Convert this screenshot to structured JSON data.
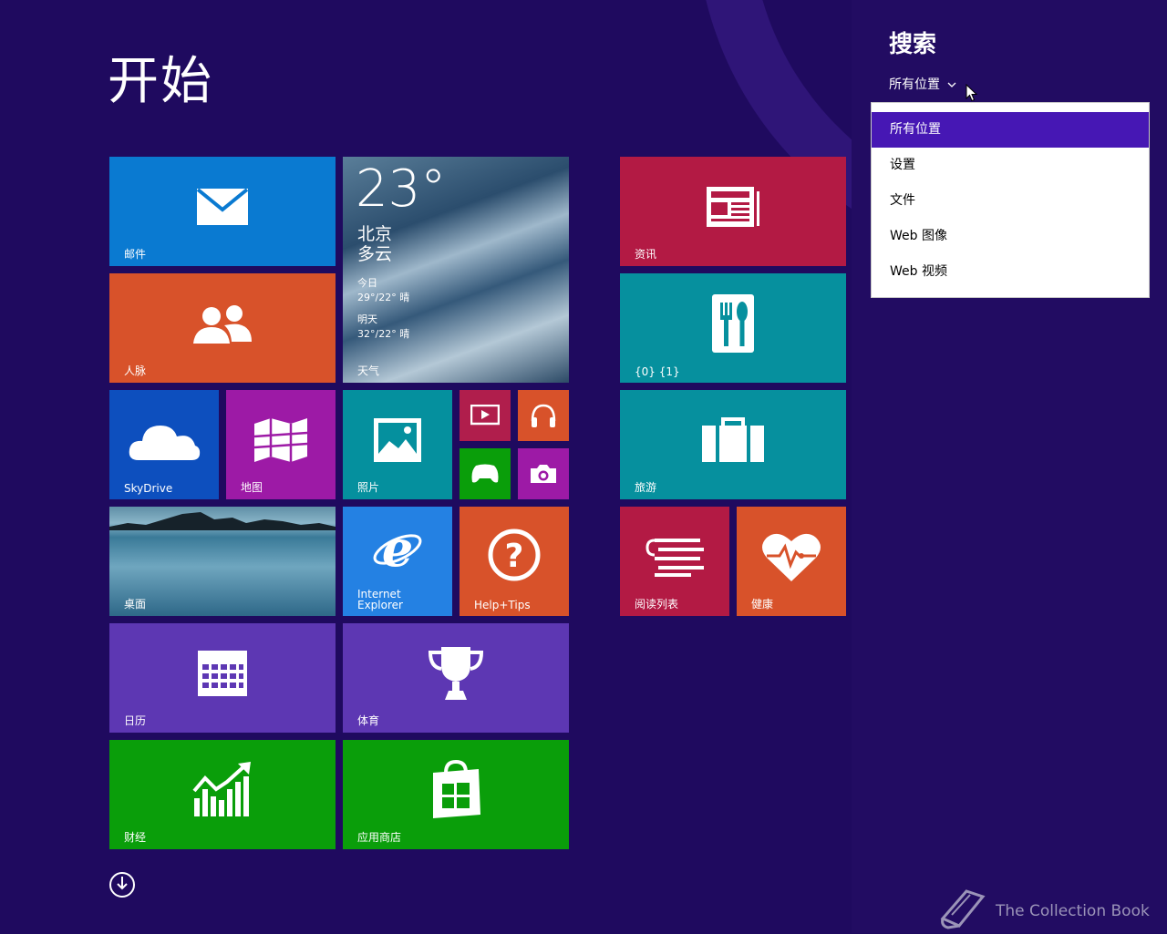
{
  "start": {
    "title": "开始",
    "tiles": {
      "mail": "邮件",
      "people": "人脉",
      "skydrive": "SkyDrive",
      "maps": "地图",
      "photos": "照片",
      "desktop": "桌面",
      "ie": "Internet\nExplorer",
      "help": "Help+Tips",
      "calendar": "日历",
      "sports": "体育",
      "finance": "财经",
      "store": "应用商店",
      "news": "资讯",
      "food": "{0} {1}",
      "travel": "旅游",
      "readinglist": "阅读列表",
      "health": "健康"
    },
    "weather": {
      "temp": "23°",
      "city": "北京",
      "condition": "多云",
      "today_label": "今日",
      "today_value": "29°/22° 晴",
      "tomorrow_label": "明天",
      "tomorrow_value": "32°/22° 晴",
      "label": "天气"
    }
  },
  "search": {
    "title": "搜索",
    "scope": "所有位置",
    "options": [
      "所有位置",
      "设置",
      "文件",
      "Web 图像",
      "Web 视频"
    ],
    "selected_index": 0
  },
  "watermark": "The Collection Book",
  "colors": {
    "background": "#1f0a5f",
    "mail": "#0a7ad1",
    "people": "#d8522a",
    "skydrive": "#0d4fbe",
    "maps": "#9d1aa6",
    "photos": "#05909e",
    "video": "#b01e4c",
    "music": "#d8522a",
    "games": "#0a9e0a",
    "camera": "#9d1aa6",
    "ie": "#2481e3",
    "help": "#d8522a",
    "calendar": "#5d37b3",
    "sports": "#5d37b3",
    "finance": "#0a9e0a",
    "store": "#0a9e0a",
    "news": "#b31a44",
    "food": "#06909e",
    "travel": "#06909e",
    "readinglist": "#b31a44",
    "health": "#d8522a",
    "selection": "#4617b4"
  }
}
